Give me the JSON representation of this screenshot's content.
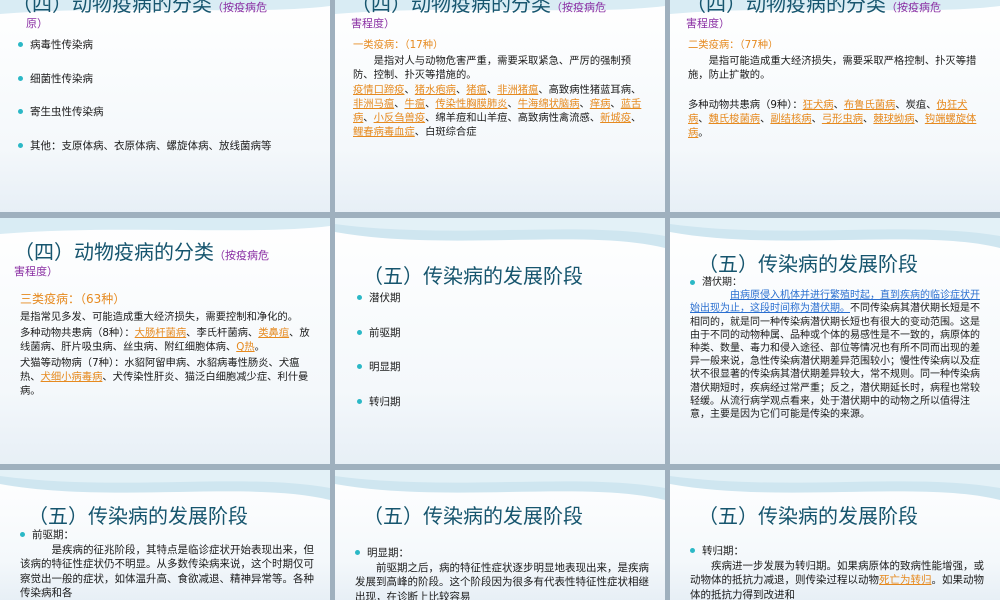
{
  "slide1": {
    "title": "（四）动物疫病的分类",
    "subtitle_a": "（按疫病危",
    "subtitle_b": "原）",
    "items": [
      "病毒性传染病",
      "细菌性传染病",
      "寄生虫性传染病",
      "其他：支原体病、衣原体病、螺旋体病、放线菌病等"
    ]
  },
  "slide2": {
    "title": "（四）动物疫病的分类",
    "subtitle_a": "（按疫病危",
    "subtitle_b": "害程度）",
    "heading": "一类疫病：（17种）",
    "para1": "是指对人与动物危害严重，需要采取紧急、严厉的强制预防、控制、扑灭等措施的。",
    "links_line1": [
      "疫情口蹄疫",
      "猪水疱病",
      "猪瘟",
      "非洲猪瘟"
    ],
    "tail1": "、高致病性猪",
    "text2a": "蓝耳病、",
    "links_line2": [
      "非洲马瘟",
      "牛瘟",
      "传染性胸膜肺炎",
      "牛海绵状脑病",
      "痒病",
      "蓝舌病",
      "小反刍兽疫"
    ],
    "tail2": "、绵羊痘和山羊痘、高致病性禽流感、",
    "links_line3": [
      "新城疫",
      "鲤春病毒血症"
    ],
    "tail3": "、白斑综合症"
  },
  "slide3": {
    "title": "（四）动物疫病的分类",
    "subtitle_a": "（按疫病危",
    "subtitle_b": "害程度）",
    "heading": "二类疫病：（77种）",
    "para1": "是指可能造成重大经济损失，需要采取严格控制、扑灭等措施，防止扩散的。",
    "lead": "多种动物共患病（9种）：",
    "links": [
      "狂犬病",
      "布鲁氏菌病",
      "炭疽",
      "伪狂犬病",
      "魏氏梭菌病",
      "副结核病",
      "弓形虫病",
      "棘球蚴病",
      "钩端螺旋体病"
    ]
  },
  "slide4": {
    "title": "（四）动物疫病的分类",
    "subtitle_a": "（按疫病危",
    "subtitle_b": "害程度）",
    "heading": "三类疫病：（63种）",
    "para1": "是指常见多发、可能造成重大经济损失，需要控制和净化的。",
    "lead2": "多种动物共患病（8种）：",
    "links2": [
      "大肠杆菌病",
      "类鼻疽",
      "Q热"
    ],
    "mid2a": "、李氏杆菌病、",
    "mid2b": "、放线菌病、肝片吸虫病、丝虫病、附红细胞体病、",
    "end2": "。",
    "lead3": "犬猫等动物病（7种）：水貂阿留申病、水貂病毒性肠炎、犬瘟热、",
    "link3": "犬细小病毒病",
    "tail3": "、犬传染性肝炎、猫泛白细胞减少症、利什曼病。"
  },
  "slide5": {
    "title": "（五）传染病的发展阶段",
    "items": [
      "潜伏期",
      "前驱期",
      "明显期",
      "转归期"
    ]
  },
  "slide6": {
    "title": "（五）传染病的发展阶段",
    "label": "潜伏期：",
    "highlight": "由病原侵入机体并进行繁殖时起，直到疾病的临诊症状开始出现为止，这段时间称为潜伏期。",
    "body": "不同传染病其潜伏期长短是不相同的，就是同一种传染病潜伏期长短也有很大的变动范围。这是由于不同的动物种属、品种或个体的易感性是不一致的，病原体的种类、数量、毒力和侵入途径、部位等情况也有所不同而出现的差异一般来说，急性传染病潜伏期差异范围较小；慢性传染病以及症状不很显著的传染病其潜伏期差异较大，常不规则。同一种传染病潜伏期短时，疾病经过常严重；反之，潜伏期延长时，病程也常较轻缓。从流行病学观点看来，处于潜伏期中的动物之所以值得注意，主要是因为它们可能是传染的来源。"
  },
  "slide7": {
    "title": "（五）传染病的发展阶段",
    "label": "前驱期：",
    "body": "是疾病的征兆阶段，其特点是临诊症状开始表现出来，但该病的特征性症状仍不明显。从多数传染病来说，这个时期仅可察觉出一般的症状，如体温升高、食欲减退、精神异常等。各种传染病和各"
  },
  "slide8": {
    "title": "（五）传染病的发展阶段",
    "label": "明显期：",
    "body": "前驱期之后，病的特征性症状逐步明显地表现出来，是疾病发展到高峰的阶段。这个阶段因为很多有代表性特征性症状相继出现，在诊断上比较容易"
  },
  "slide9": {
    "title": "（五）传染病的发展阶段",
    "label": "转归期：",
    "body_a": "疾病进一步发展为转归期。如果病原体的致病性能增强，或动物体的抵抗力减退，则传染过程以动物",
    "link": "死亡为转归",
    "body_b": "。如果动物体的抵抗力得到改进和"
  },
  "colors": {
    "title": "#16556e",
    "accent": "#2bb8c6",
    "orange": "#e68a1f",
    "purple": "#8a2fa3",
    "blue_link": "#2a6fd0"
  }
}
